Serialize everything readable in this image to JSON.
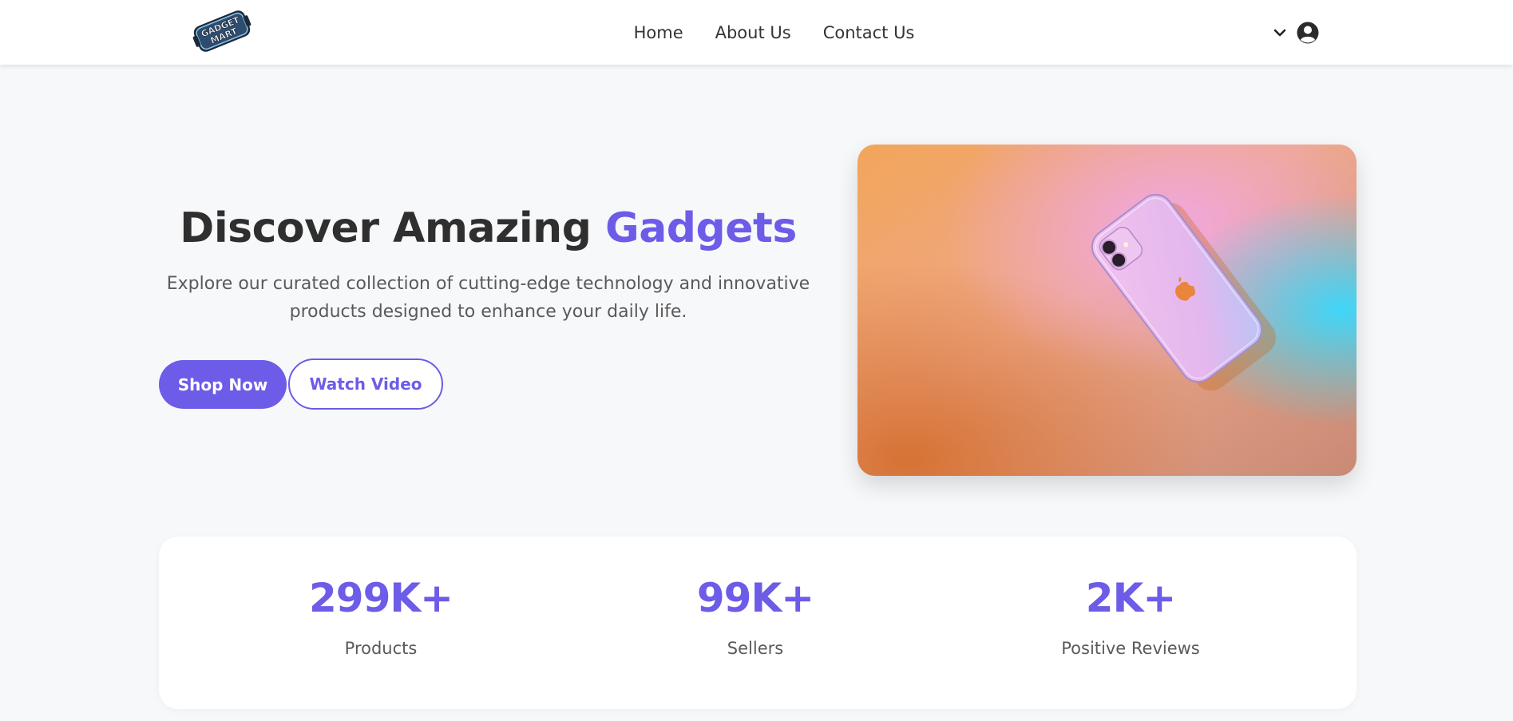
{
  "brand": {
    "logo_line1": "GADGET",
    "logo_line2": "MART"
  },
  "nav": {
    "links": [
      "Home",
      "About Us",
      "Contact Us"
    ],
    "dropdown_icon": "chevron-down-icon",
    "account_icon": "user-circle-icon"
  },
  "hero": {
    "title_main": "Discover Amazing ",
    "title_accent": "Gadgets",
    "subtitle": "Explore our curated collection of cutting-edge technology and innovative products designed to enhance your daily life.",
    "primary_button": "Shop Now",
    "secondary_button": "Watch Video"
  },
  "stats": [
    {
      "value": "299K+",
      "label": "Products"
    },
    {
      "value": "99K+",
      "label": "Sellers"
    },
    {
      "value": "2K+",
      "label": "Positive Reviews"
    }
  ],
  "colors": {
    "accent": "#6c5ce7",
    "page_bg": "#f7f8fa",
    "heading": "#2f2f2f",
    "body_text": "#5a5a5a"
  }
}
